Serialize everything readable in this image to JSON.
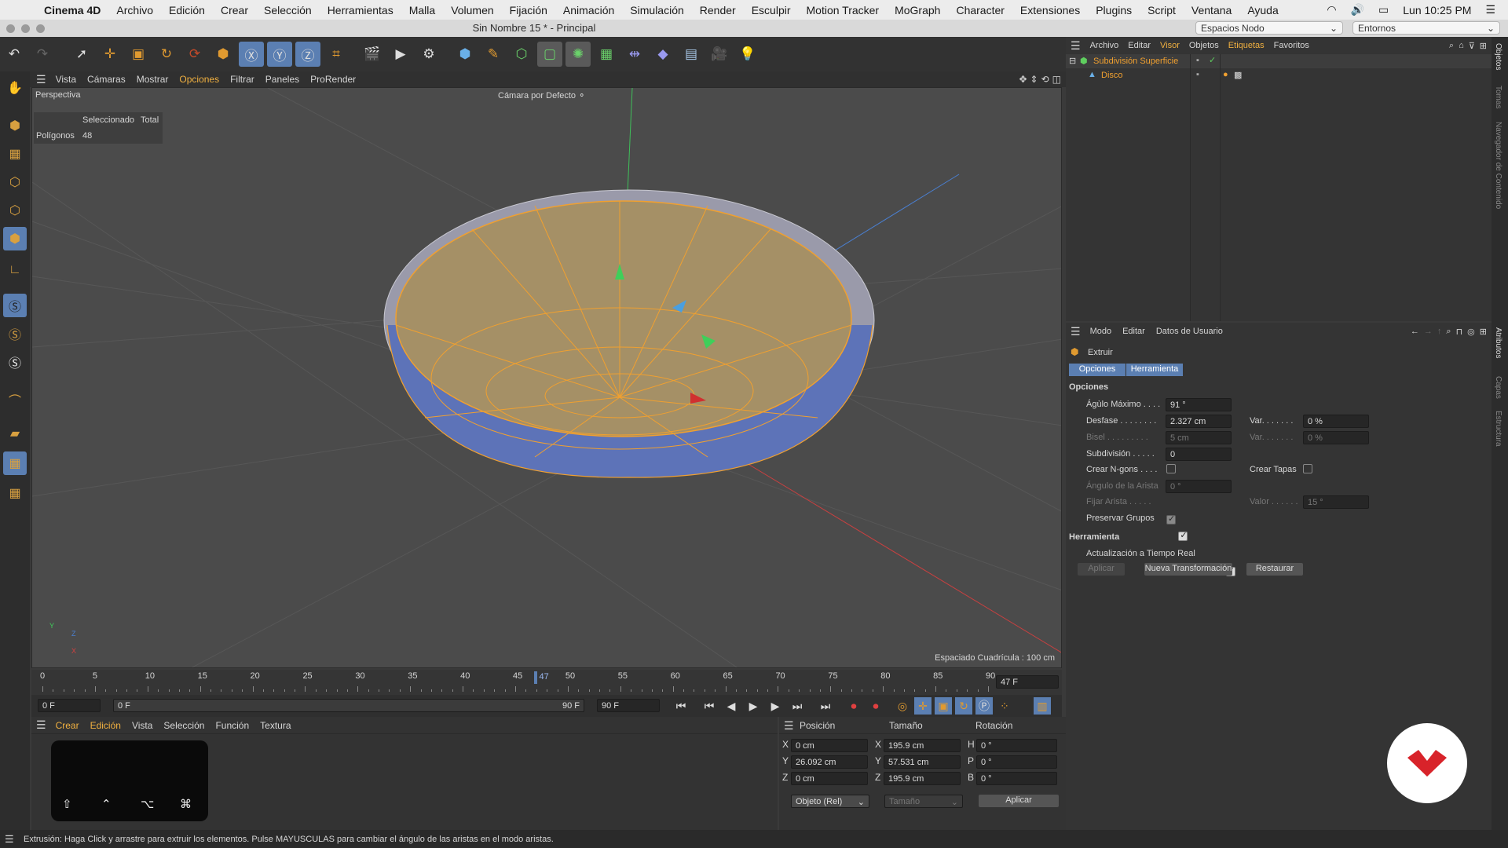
{
  "menubar": {
    "app": "Cinema 4D",
    "items": [
      "Archivo",
      "Edición",
      "Crear",
      "Selección",
      "Herramientas",
      "Malla",
      "Volumen",
      "Fijación",
      "Animación",
      "Simulación",
      "Render",
      "Esculpir",
      "Motion Tracker",
      "MoGraph",
      "Character",
      "Extensiones",
      "Plugins",
      "Script",
      "Ventana",
      "Ayuda"
    ],
    "clock": "Lun 10:25 PM"
  },
  "window": {
    "title": "Sin Nombre 15 * - Principal",
    "layout_select": "Espacios Nodo",
    "env_select": "Entornos"
  },
  "viewport": {
    "menu": [
      "Vista",
      "Cámaras",
      "Mostrar",
      "Opciones",
      "Filtrar",
      "Paneles",
      "ProRender"
    ],
    "active_menu": "Opciones",
    "view_name": "Perspectiva",
    "camera": "Cámara por Defecto",
    "hud": {
      "col1": "Seleccionado",
      "col2": "Total",
      "row_label": "Polígonos",
      "row_value": "48"
    },
    "grid_spacing": "Espaciado Cuadrícula : 100 cm",
    "axis_labels": {
      "y": "Y",
      "z": "Z",
      "x": "X"
    }
  },
  "timeline": {
    "ticks": [
      "0",
      "5",
      "10",
      "15",
      "20",
      "25",
      "30",
      "35",
      "40",
      "45",
      "50",
      "55",
      "60",
      "65",
      "70",
      "75",
      "80",
      "85",
      "90"
    ],
    "current": "47",
    "current_frame_field": "47 F",
    "start_field": "0 F",
    "range_start": "0 F",
    "range_end": "90 F",
    "end_field": "90 F",
    "progress": 0.522
  },
  "material": {
    "menu": [
      "Crear",
      "Edición",
      "Vista",
      "Selección",
      "Función",
      "Textura"
    ],
    "keys": [
      "⇧",
      "⌃",
      "⌥",
      "⌘"
    ]
  },
  "coords": {
    "headers": [
      "Posición",
      "Tamaño",
      "Rotación"
    ],
    "rows": [
      {
        "axis": "X",
        "pos": "0 cm",
        "size_axis": "X",
        "size": "195.9 cm",
        "rot_axis": "H",
        "rot": "0 °"
      },
      {
        "axis": "Y",
        "pos": "26.092 cm",
        "size_axis": "Y",
        "size": "57.531 cm",
        "rot_axis": "P",
        "rot": "0 °"
      },
      {
        "axis": "Z",
        "pos": "0 cm",
        "size_axis": "Z",
        "size": "195.9 cm",
        "rot_axis": "B",
        "rot": "0 °"
      }
    ],
    "mode": "Objeto (Rel)",
    "size_mode": "Tamaño",
    "apply": "Aplicar"
  },
  "objects": {
    "menu": [
      "Archivo",
      "Editar",
      "Visor",
      "Objetos",
      "Etiquetas",
      "Favoritos"
    ],
    "items": [
      {
        "name": "Subdivisión Superficie"
      },
      {
        "name": "Disco"
      }
    ]
  },
  "attributes": {
    "menu": [
      "Modo",
      "Editar",
      "Datos de Usuario"
    ],
    "tool": "Extruir",
    "tabs": [
      "Opciones",
      "Herramienta"
    ],
    "section_options": "Opciones",
    "fields": {
      "angle_label": "Ágùlo Máximo . . . .",
      "angle_value": "91 °",
      "offset_label": "Desfase . . . . . . . .",
      "offset_value": "2.327 cm",
      "var1_label": "Var. . . . . . .",
      "var1_value": "0 %",
      "bevel_label": "Bisel . . . . . . . . .",
      "bevel_value": "5 cm",
      "var2_label": "Var. . . . . . .",
      "var2_value": "0 %",
      "subdiv_label": "Subdivisión . . . . .",
      "subdiv_value": "0",
      "ngons_label": "Crear N-gons . . . .",
      "caps_label": "Crear Tapas",
      "edge_angle_label": "Ángulo de la Arista",
      "edge_angle_value": "0 °",
      "fix_edge_label": "Fijar Arista . . . . .",
      "value_label": "Valor . . . . . .",
      "value_value": "15 °",
      "preserve_label": "Preservar Grupos"
    },
    "section_tool": "Herramienta",
    "realtime_label": "Actualización a Tiempo Real",
    "buttons": [
      "Aplicar",
      "Nueva Transformación",
      "Restaurar"
    ]
  },
  "side_tabs": [
    "Objetos",
    "Tomas",
    "Navegador de Contenido",
    "Atributos",
    "Capas",
    "Estructura"
  ],
  "status": "Extrusión: Haga Click y arrastre para extruir los elementos. Pulse MAYUSCULAS para cambiar el ángulo de las aristas en el modo aristas.",
  "colors": {
    "accent": "#5b7fb2",
    "selection": "#f0a030",
    "badge": "#d8232a"
  }
}
